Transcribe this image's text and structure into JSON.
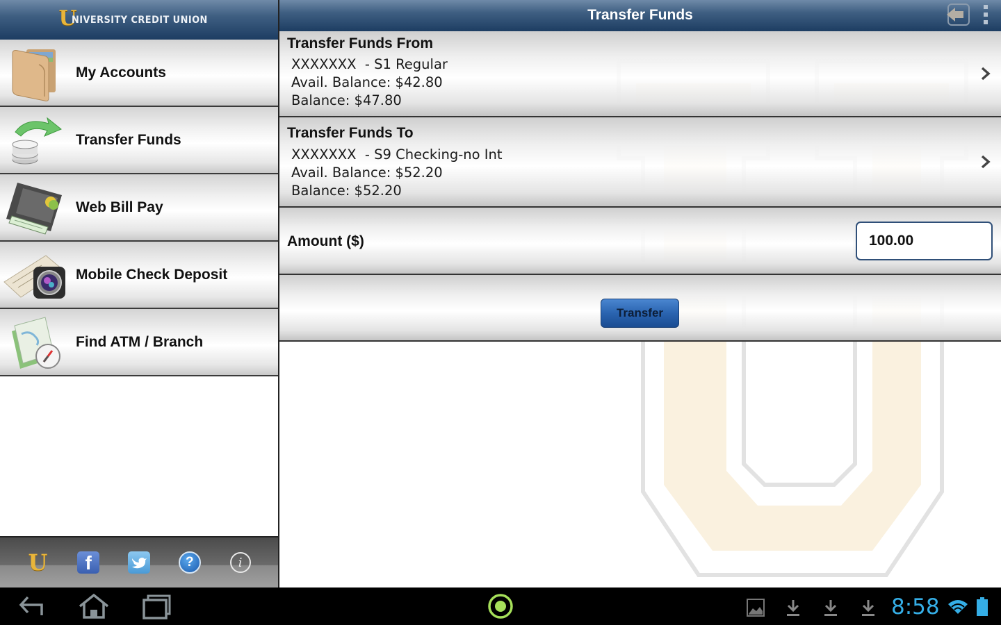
{
  "brand": {
    "logo_letter": "U",
    "name": "NIVERSITY CREDIT UNION"
  },
  "sidebar": {
    "items": [
      {
        "label": "My Accounts",
        "icon": "wallet-icon"
      },
      {
        "label": "Transfer Funds",
        "icon": "transfer-coins-icon"
      },
      {
        "label": "Web Bill Pay",
        "icon": "checkbook-icon"
      },
      {
        "label": "Mobile Check Deposit",
        "icon": "camera-check-icon"
      },
      {
        "label": "Find ATM / Branch",
        "icon": "map-compass-icon"
      }
    ],
    "bottom_icons": [
      {
        "name": "university-logo-icon",
        "glyph": "U"
      },
      {
        "name": "facebook-icon",
        "glyph": "f"
      },
      {
        "name": "twitter-icon",
        "glyph": "bird"
      },
      {
        "name": "help-icon",
        "glyph": "?"
      },
      {
        "name": "info-icon",
        "glyph": "i"
      }
    ]
  },
  "header": {
    "title": "Transfer Funds",
    "back_icon": "exit-back-icon",
    "overflow_icon": "overflow-menu-icon"
  },
  "from_account": {
    "heading": "Transfer Funds From",
    "account": "XXXXXXX  - S1 Regular",
    "available": "Avail. Balance: $42.80",
    "balance": "Balance: $47.80"
  },
  "to_account": {
    "heading": "Transfer Funds To",
    "account": "XXXXXXX  - S9 Checking-no Int",
    "available": "Avail. Balance: $52.20",
    "balance": "Balance: $52.20"
  },
  "amount": {
    "label": "Amount ($)",
    "value": "100.00"
  },
  "transfer_button": {
    "label": "Transfer"
  },
  "colors": {
    "header_blue": "#1d3d62",
    "accent_gold": "#e9b53a",
    "button_blue": "#2a64b0",
    "clock_blue": "#35aee6",
    "home_green": "#a6e05a"
  },
  "system_bar": {
    "time": "8:58",
    "nav": [
      "back-icon",
      "home-icon",
      "recent-apps-icon"
    ],
    "center": "app-launcher-icon",
    "notifications": [
      "image-icon",
      "download-icon",
      "download-icon",
      "download-icon"
    ],
    "status": [
      "wifi-icon",
      "battery-icon"
    ]
  }
}
